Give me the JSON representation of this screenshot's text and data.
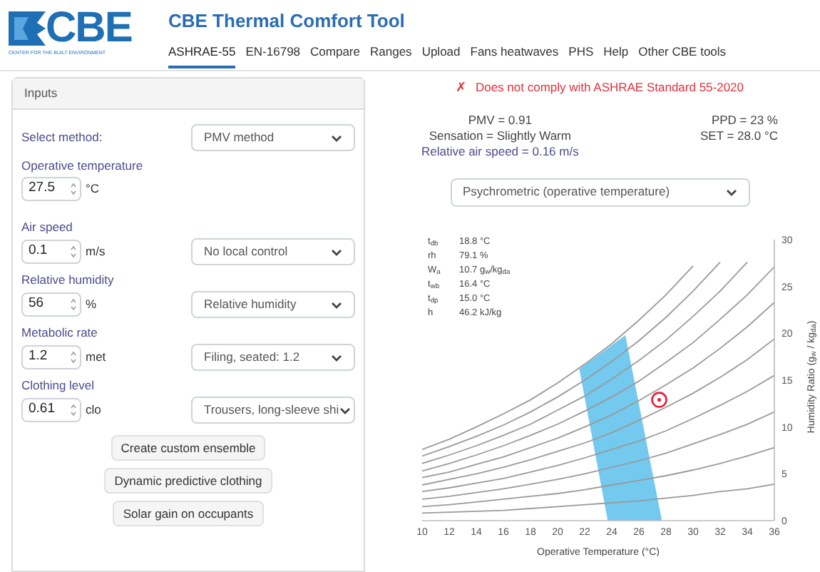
{
  "header": {
    "logo_text": "CBE",
    "logo_caption": "CENTER FOR THE BUILT ENVIRONMENT",
    "title": "CBE Thermal Comfort Tool"
  },
  "tabs": [
    {
      "label": "ASHRAE-55",
      "selected": true
    },
    {
      "label": "EN-16798",
      "selected": false
    },
    {
      "label": "Compare",
      "selected": false
    },
    {
      "label": "Ranges",
      "selected": false
    },
    {
      "label": "Upload",
      "selected": false
    },
    {
      "label": "Fans heatwaves",
      "selected": false
    },
    {
      "label": "PHS",
      "selected": false
    },
    {
      "label": "Help",
      "selected": false
    },
    {
      "label": "Other CBE tools",
      "selected": false
    }
  ],
  "inputs": {
    "title": "Inputs",
    "fields": [
      {
        "kind": "select",
        "label": "Select method:",
        "select": "PMV method"
      },
      {
        "kind": "number",
        "label": "Operative temperature",
        "value": "27.5",
        "unit": "°C"
      },
      {
        "kind": "number",
        "label": "Air speed",
        "value": "0.1",
        "unit": "m/s",
        "select": "No local control"
      },
      {
        "kind": "number",
        "label": "Relative humidity",
        "value": "56",
        "unit": "%",
        "select": "Relative humidity"
      },
      {
        "kind": "number",
        "label": "Metabolic rate",
        "value": "1.2",
        "unit": "met",
        "select": "Filing, seated: 1.2"
      },
      {
        "kind": "number",
        "label": "Clothing level",
        "value": "0.61",
        "unit": "clo",
        "select": "Trousers, long-sleeve shi"
      }
    ],
    "buttons": [
      "Create custom ensemble",
      "Dynamic predictive clothing",
      "Solar gain on occupants"
    ]
  },
  "results": {
    "compliance_icon": "✗",
    "compliance": "Does not comply with ASHRAE Standard 55-2020",
    "compliant": false,
    "left": [
      {
        "text": "PMV = 0.91",
        "kind": "plain"
      },
      {
        "text": "Sensation = Slightly Warm",
        "kind": "plain"
      },
      {
        "text": "Relative air speed = 0.16 m/s",
        "kind": "accent"
      }
    ],
    "right": [
      "PPD = 23 %",
      "SET = 28.0 °C"
    ],
    "chart_select": "Psychrometric (operative temperature)"
  },
  "hover_info": [
    {
      "label": "t$_{db}$",
      "value": "18.8 °C"
    },
    {
      "label": "rh",
      "value": "79.1 %"
    },
    {
      "label": "W$_{a}$",
      "value": "10.7 g$_{w}$/kg$_{da}$"
    },
    {
      "label": "t$_{wb}$",
      "value": "16.4 °C"
    },
    {
      "label": "t$_{dp}$",
      "value": "15.0 °C"
    },
    {
      "label": "h",
      "value": "46.2 kJ/kg"
    }
  ],
  "chart_data": {
    "type": "line",
    "xlabel": "Operative Temperature (°C)",
    "ylabel": "Humidity Ratio (g$_{w}$ / kg$_{da}$)",
    "x": [
      10,
      12,
      14,
      16,
      18,
      20,
      22,
      24,
      26,
      28,
      30,
      32,
      34,
      36
    ],
    "xlim": [
      10,
      36
    ],
    "ylim": [
      0,
      30
    ],
    "xticks": [
      10,
      12,
      14,
      16,
      18,
      20,
      22,
      24,
      26,
      28,
      30,
      32,
      34,
      36
    ],
    "yticks": [
      0,
      5,
      10,
      15,
      20,
      25,
      30
    ],
    "series": [
      {
        "values": [
          0.8,
          0.9,
          1.0,
          1.1,
          1.3,
          1.5,
          1.7,
          1.9,
          2.1,
          2.4,
          2.7,
          3.1,
          3.4,
          3.9
        ]
      },
      {
        "values": [
          1.5,
          1.7,
          2.0,
          2.3,
          2.6,
          2.9,
          3.3,
          3.8,
          4.3,
          4.8,
          5.4,
          6.1,
          6.9,
          7.8
        ]
      },
      {
        "values": [
          2.3,
          2.6,
          3.0,
          3.4,
          3.9,
          4.4,
          5.0,
          5.7,
          6.4,
          7.2,
          8.2,
          9.2,
          10.3,
          11.6
        ]
      },
      {
        "values": [
          3.1,
          3.5,
          4.0,
          4.5,
          5.2,
          5.9,
          6.7,
          7.6,
          8.5,
          9.6,
          10.9,
          12.3,
          13.8,
          15.5
        ]
      },
      {
        "values": [
          3.8,
          4.4,
          5.0,
          5.7,
          6.5,
          7.4,
          8.3,
          9.4,
          10.7,
          12.1,
          13.6,
          15.3,
          17.2,
          19.4
        ]
      },
      {
        "values": [
          4.6,
          5.2,
          6.0,
          6.8,
          7.8,
          8.8,
          10.0,
          11.3,
          12.8,
          14.5,
          16.3,
          18.4,
          20.7,
          23.3
        ]
      },
      {
        "values": [
          5.3,
          6.1,
          7.0,
          8.0,
          9.1,
          10.3,
          11.7,
          13.2,
          14.9,
          16.9,
          19.0,
          21.5,
          24.1,
          27.1
        ]
      },
      {
        "values": [
          6.1,
          7.0,
          8.0,
          9.1,
          10.3,
          11.8,
          13.3,
          15.1,
          17.1,
          19.3,
          21.8,
          24.5,
          27.6,
          null
        ]
      },
      {
        "values": [
          6.9,
          7.9,
          9.0,
          10.2,
          11.6,
          13.2,
          15.0,
          17.0,
          19.2,
          21.7,
          24.5,
          27.6,
          null,
          null
        ]
      },
      {
        "values": [
          7.6,
          8.7,
          10.0,
          11.4,
          12.9,
          14.7,
          16.7,
          18.9,
          21.4,
          24.1,
          27.2,
          null,
          null,
          null
        ]
      }
    ]
  }
}
